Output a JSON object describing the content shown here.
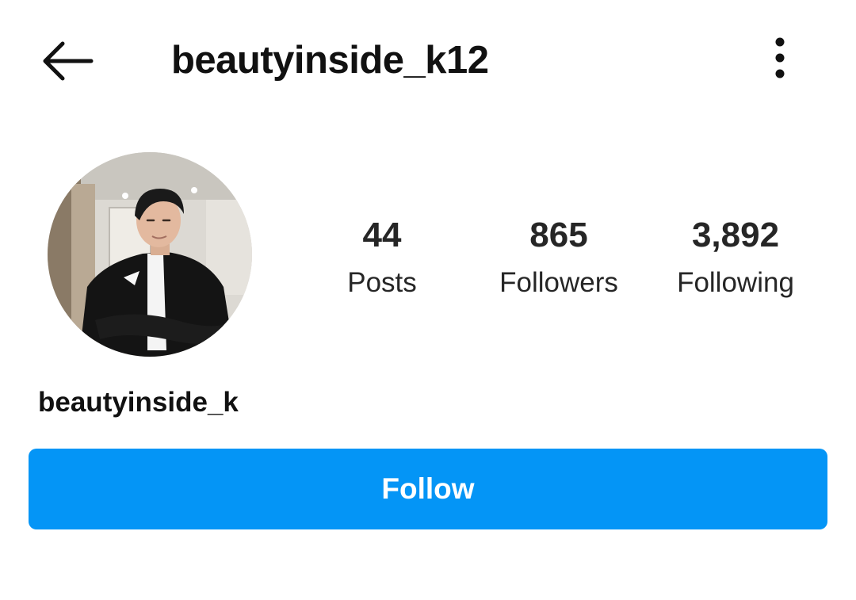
{
  "header": {
    "username": "beautyinside_k12",
    "back_icon": "arrow-left-icon",
    "more_icon": "more-vertical-icon"
  },
  "profile": {
    "avatar_icon": "profile-photo",
    "display_name": "beautyinside_k",
    "stats": [
      {
        "count": "44",
        "label": "Posts"
      },
      {
        "count": "865",
        "label": "Followers"
      },
      {
        "count": "3,892",
        "label": "Following"
      }
    ]
  },
  "actions": {
    "follow_label": "Follow"
  },
  "colors": {
    "accent": "#0495f6",
    "text": "#111111",
    "background": "#ffffff"
  }
}
